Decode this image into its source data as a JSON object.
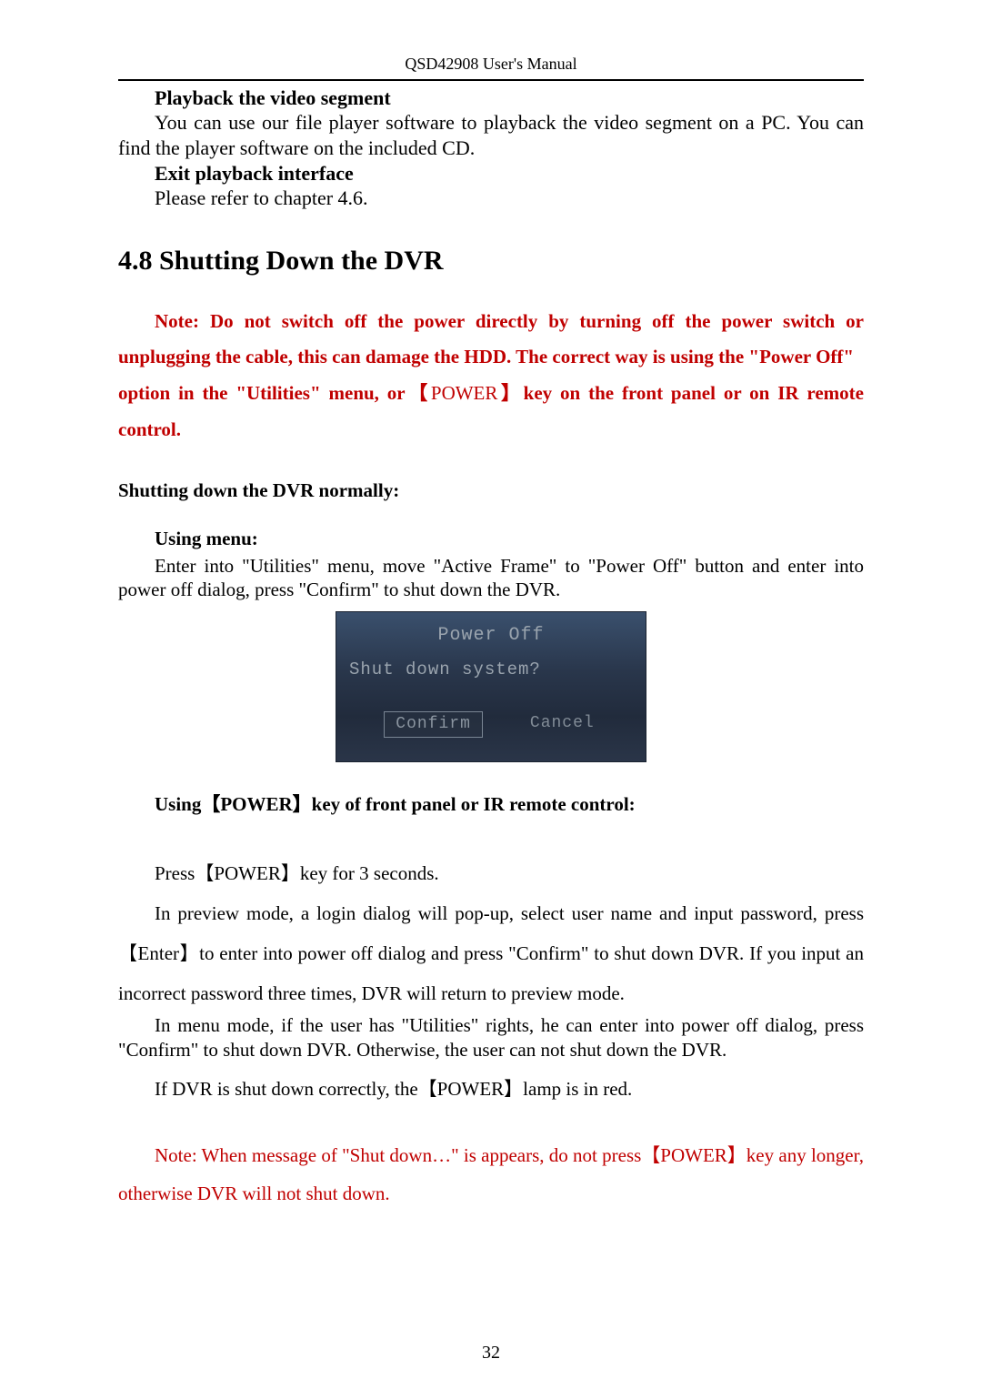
{
  "header": "QSD42908 User's Manual",
  "playback": {
    "heading": "Playback the video segment",
    "text": "You can use our file player software to playback the video segment on a PC. You can find the player software on the included CD."
  },
  "exit": {
    "heading": "Exit playback interface",
    "text": "Please refer to chapter 4.6."
  },
  "section": {
    "number": "4.8",
    "title": "Shutting Down the DVR"
  },
  "note_red": {
    "line1": "Note: Do not switch off the power directly by turning off the power switch or unplugging the cable, this can damage the HDD. The correct way is using the \"Power Off\"",
    "line2a": "option in the \"Utilities\" menu, or【",
    "power_word": "POWER",
    "line2b": "】key on the front panel or on IR remote control."
  },
  "normally_heading": "Shutting down the DVR normally:",
  "using_menu": {
    "heading": "Using menu:",
    "text": "Enter into \"Utilities\" menu, move \"Active Frame\" to \"Power Off\" button and enter into power off dialog, press \"Confirm\" to shut down the DVR."
  },
  "dialog": {
    "title": "Power Off",
    "question": "Shut down system?",
    "confirm": "Confirm",
    "cancel": "Cancel"
  },
  "using_power_heading": "Using【POWER】key of front panel or IR remote control:",
  "press_power": "Press【POWER】key for 3 seconds.",
  "preview_mode": "In preview mode, a login dialog will pop-up, select user name and input password, press 【Enter】to enter into power off dialog and press \"Confirm\" to shut down DVR. If you input an incorrect password three times, DVR will return to preview mode.",
  "menu_mode": "In menu mode, if the user has \"Utilities\" rights, he can enter into power off dialog, press \"Confirm\" to shut down DVR. Otherwise, the user can not shut down the DVR.",
  "lamp_red": "If DVR is shut down correctly, the【POWER】lamp is in red.",
  "bottom_note": "Note: When message of \"Shut down…\" is appears, do not press【POWER】key any longer, otherwise DVR will not shut down.",
  "page_number": "32"
}
